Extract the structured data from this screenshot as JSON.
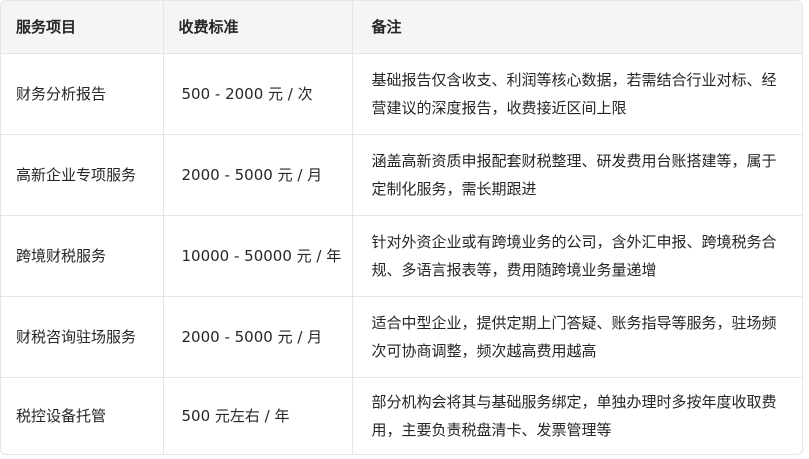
{
  "table": {
    "headers": [
      "服务项目",
      "收费标准",
      "备注"
    ],
    "rows": [
      [
        "财务分析报告",
        "500 - 2000 元 / 次",
        "基础报告仅含收支、利润等核心数据，若需结合行业对标、经营建议的深度报告，收费接近区间上限"
      ],
      [
        "高新企业专项服务",
        "2000 - 5000 元 / 月",
        "涵盖高新资质申报配套财税整理、研发费用台账搭建等，属于定制化服务，需长期跟进"
      ],
      [
        "跨境财税服务",
        "10000 - 50000 元 / 年",
        "针对外资企业或有跨境业务的公司，含外汇申报、跨境税务合规、多语言报表等，费用随跨境业务量递增"
      ],
      [
        "财税咨询驻场服务",
        "2000 - 5000 元 / 月",
        "适合中型企业，提供定期上门答疑、账务指导等服务，驻场频次可协商调整，频次越高费用越高"
      ],
      [
        "税控设备托管",
        "500 元左右 / 年",
        "部分机构会将其与基础服务绑定，单独办理时多按年度收取费用，主要负责税盘清卡、发票管理等"
      ]
    ]
  }
}
